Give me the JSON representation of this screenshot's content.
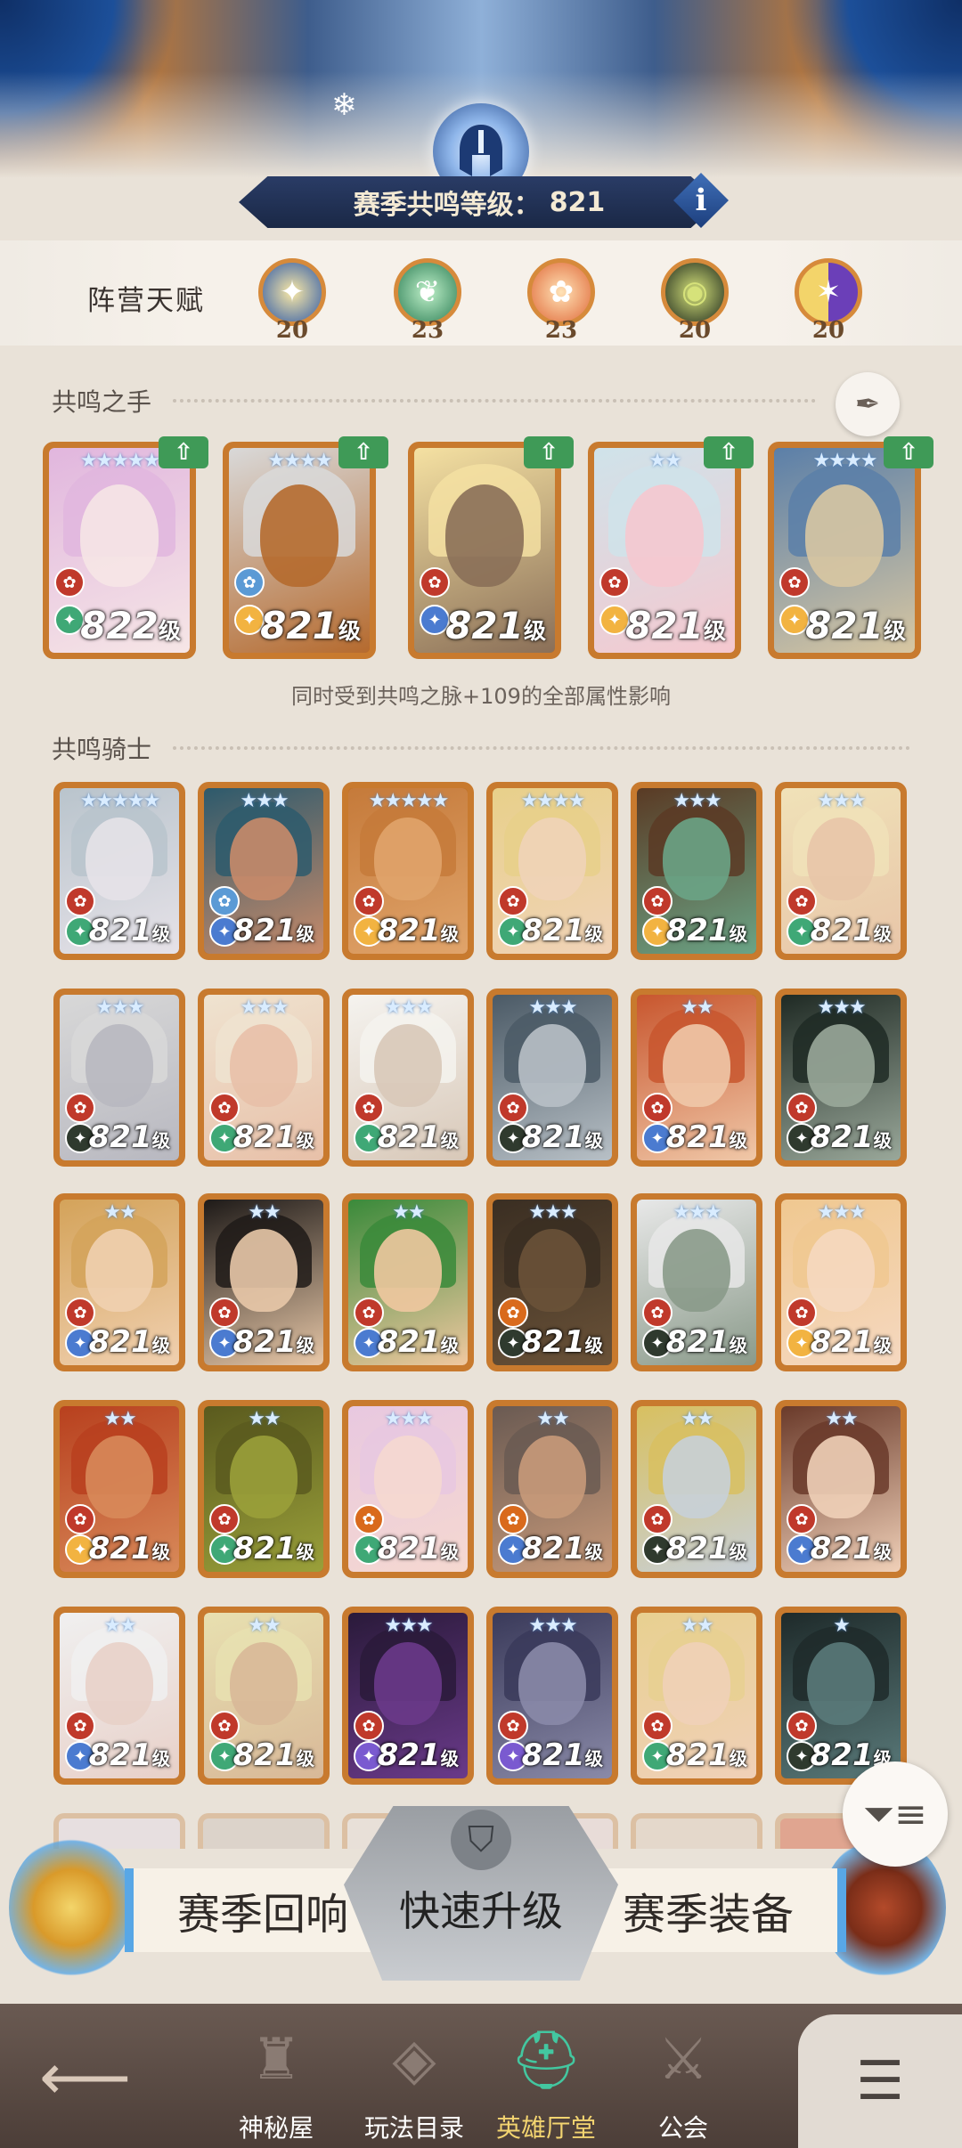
{
  "header": {
    "level_label": "赛季共鸣等级：",
    "level_value": "821",
    "info_icon": "i"
  },
  "faction": {
    "title": "阵营天赋",
    "items": [
      {
        "icon": "lightbearer-icon",
        "count": "20",
        "color": "#f2b341"
      },
      {
        "icon": "mauler-icon",
        "count": "23",
        "color": "#3fa876"
      },
      {
        "icon": "wilder-icon",
        "count": "23",
        "color": "#e0663a"
      },
      {
        "icon": "graveborn-icon",
        "count": "20",
        "color": "#2f3a2e"
      },
      {
        "icon": "celestial-hypogean-icon",
        "count": "20",
        "color": "#7a5ad0"
      }
    ]
  },
  "hands": {
    "title": "共鸣之手",
    "note": "同时受到共鸣之脉+109的全部属性影响",
    "cards": [
      {
        "level": "822",
        "unit": "级",
        "stars": "★★★★★",
        "class": "#c0392b",
        "faction": "#3fa876",
        "palette": [
          "#e1b6de",
          "#f6e6e6"
        ]
      },
      {
        "level": "821",
        "unit": "级",
        "stars": "★★★★",
        "class": "#5b9ad5",
        "faction": "#f2b341",
        "palette": [
          "#d9d9d9",
          "#b56a2e"
        ]
      },
      {
        "level": "821",
        "unit": "级",
        "stars": "",
        "class": "#c0392b",
        "faction": "#4b7bd0",
        "palette": [
          "#f5e1a2",
          "#8a6f58"
        ]
      },
      {
        "level": "821",
        "unit": "级",
        "stars": "★★",
        "class": "#c0392b",
        "faction": "#f2b341",
        "palette": [
          "#cfe3ea",
          "#f5c8cf"
        ]
      },
      {
        "level": "821",
        "unit": "级",
        "stars": "★★★★",
        "class": "#c0392b",
        "faction": "#f2b341",
        "palette": [
          "#5b7fa8",
          "#d8c7a2"
        ]
      }
    ]
  },
  "knights": {
    "title": "共鸣骑士",
    "cards": [
      {
        "level": "821",
        "unit": "级",
        "stars": "★★★★★",
        "class": "#c0392b",
        "faction": "#3fa876",
        "palette": [
          "#b9c4cc",
          "#e6e2e8"
        ]
      },
      {
        "level": "821",
        "unit": "级",
        "stars": "★★★",
        "class": "#5b9ad5",
        "faction": "#4b7bd0",
        "palette": [
          "#2d5a6c",
          "#c98b6a"
        ]
      },
      {
        "level": "821",
        "unit": "级",
        "stars": "★★★★★",
        "class": "#c0392b",
        "faction": "#f2b341",
        "palette": [
          "#c57a3a",
          "#e0a46b"
        ]
      },
      {
        "level": "821",
        "unit": "级",
        "stars": "★★★★",
        "class": "#c0392b",
        "faction": "#3fa876",
        "palette": [
          "#e8d08a",
          "#f0d3b8"
        ]
      },
      {
        "level": "821",
        "unit": "级",
        "stars": "★★★",
        "class": "#c0392b",
        "faction": "#f2b341",
        "palette": [
          "#5a3a24",
          "#6aa486"
        ]
      },
      {
        "level": "821",
        "unit": "级",
        "stars": "★★★",
        "class": "#c0392b",
        "faction": "#3fa876",
        "palette": [
          "#f0e2b8",
          "#e8c5a8"
        ]
      },
      {
        "level": "821",
        "unit": "级",
        "stars": "★★★",
        "class": "#c0392b",
        "faction": "#2f3a2e",
        "palette": [
          "#d8d8d8",
          "#b8b8c0"
        ]
      },
      {
        "level": "821",
        "unit": "级",
        "stars": "★★★",
        "class": "#c0392b",
        "faction": "#3fa876",
        "palette": [
          "#efe3d0",
          "#e8c0a8"
        ]
      },
      {
        "level": "821",
        "unit": "级",
        "stars": "★★★",
        "class": "#c0392b",
        "faction": "#3fa876",
        "palette": [
          "#f5f3ef",
          "#d8c8b8"
        ]
      },
      {
        "level": "821",
        "unit": "级",
        "stars": "★★★",
        "class": "#c0392b",
        "faction": "#2f3a2e",
        "palette": [
          "#4b5a66",
          "#b8c0c6"
        ]
      },
      {
        "level": "821",
        "unit": "级",
        "stars": "★★",
        "class": "#c0392b",
        "faction": "#4b7bd0",
        "palette": [
          "#c8562e",
          "#f0c8a8"
        ]
      },
      {
        "level": "821",
        "unit": "级",
        "stars": "★★★",
        "class": "#c0392b",
        "faction": "#2f3a2e",
        "palette": [
          "#1f2a24",
          "#9aa89a"
        ]
      },
      {
        "level": "821",
        "unit": "级",
        "stars": "★★",
        "class": "#c0392b",
        "faction": "#4b7bd0",
        "palette": [
          "#d4a35a",
          "#f0d0b0"
        ]
      },
      {
        "level": "821",
        "unit": "级",
        "stars": "★★",
        "class": "#c0392b",
        "faction": "#4b7bd0",
        "palette": [
          "#1e1a18",
          "#e8c8a8"
        ]
      },
      {
        "level": "821",
        "unit": "级",
        "stars": "★★",
        "class": "#c0392b",
        "faction": "#4b7bd0",
        "palette": [
          "#3a8a3a",
          "#f0c8a0"
        ]
      },
      {
        "level": "821",
        "unit": "级",
        "stars": "★★★",
        "class": "#d96a1c",
        "faction": "#2f3a2e",
        "palette": [
          "#3a2e22",
          "#6a5238"
        ]
      },
      {
        "level": "821",
        "unit": "级",
        "stars": "★★★",
        "class": "#c0392b",
        "faction": "#2f3a2e",
        "palette": [
          "#e8e8e8",
          "#8a9a8a"
        ]
      },
      {
        "level": "821",
        "unit": "级",
        "stars": "★★★",
        "class": "#c0392b",
        "faction": "#f2b341",
        "palette": [
          "#f0c890",
          "#f5d8c0"
        ]
      },
      {
        "level": "821",
        "unit": "级",
        "stars": "★★",
        "class": "#c0392b",
        "faction": "#f2b341",
        "palette": [
          "#b8401e",
          "#d88a5a"
        ]
      },
      {
        "level": "821",
        "unit": "级",
        "stars": "★★",
        "class": "#c0392b",
        "faction": "#3fa876",
        "palette": [
          "#5a5a1e",
          "#9aa03a"
        ]
      },
      {
        "level": "821",
        "unit": "级",
        "stars": "★★★",
        "class": "#d96a1c",
        "faction": "#3fa876",
        "palette": [
          "#e8c8e0",
          "#f5d8d0"
        ]
      },
      {
        "level": "821",
        "unit": "级",
        "stars": "★★",
        "class": "#d96a1c",
        "faction": "#4b7bd0",
        "palette": [
          "#6a5a52",
          "#c89a7a"
        ]
      },
      {
        "level": "821",
        "unit": "级",
        "stars": "★★",
        "class": "#c0392b",
        "faction": "#2f3a2e",
        "palette": [
          "#d8c060",
          "#c8d0d8"
        ]
      },
      {
        "level": "821",
        "unit": "级",
        "stars": "★★",
        "class": "#c0392b",
        "faction": "#4b7bd0",
        "palette": [
          "#6a3a2a",
          "#f0d0b8"
        ]
      },
      {
        "level": "821",
        "unit": "级",
        "stars": "★★",
        "class": "#c0392b",
        "faction": "#4b7bd0",
        "palette": [
          "#f0f0f0",
          "#e8d0c8"
        ]
      },
      {
        "level": "821",
        "unit": "级",
        "stars": "★★",
        "class": "#c0392b",
        "faction": "#3fa876",
        "palette": [
          "#e8e0b0",
          "#d8b898"
        ]
      },
      {
        "level": "821",
        "unit": "级",
        "stars": "★★★",
        "class": "#c0392b",
        "faction": "#7a5ad0",
        "palette": [
          "#2a1a3a",
          "#6a3a8a"
        ]
      },
      {
        "level": "821",
        "unit": "级",
        "stars": "★★★",
        "class": "#c0392b",
        "faction": "#7a5ad0",
        "palette": [
          "#3a3a5a",
          "#8a8aa8"
        ]
      },
      {
        "level": "821",
        "unit": "级",
        "stars": "★★",
        "class": "#c0392b",
        "faction": "#3fa876",
        "palette": [
          "#e8d090",
          "#f0d0b8"
        ]
      },
      {
        "level": "821",
        "unit": "级",
        "stars": "★",
        "class": "#c0392b",
        "faction": "#2f3a2e",
        "palette": [
          "#1e2a2a",
          "#5a7a7a"
        ]
      }
    ]
  },
  "bottom": {
    "echo_label": "赛季回响",
    "quick_label": "快速升级",
    "equip_label": "赛季装备"
  },
  "nav": {
    "items": [
      {
        "label": "神秘屋"
      },
      {
        "label": "玩法目录"
      },
      {
        "label": "英雄厅堂"
      },
      {
        "label": "公会"
      }
    ]
  }
}
